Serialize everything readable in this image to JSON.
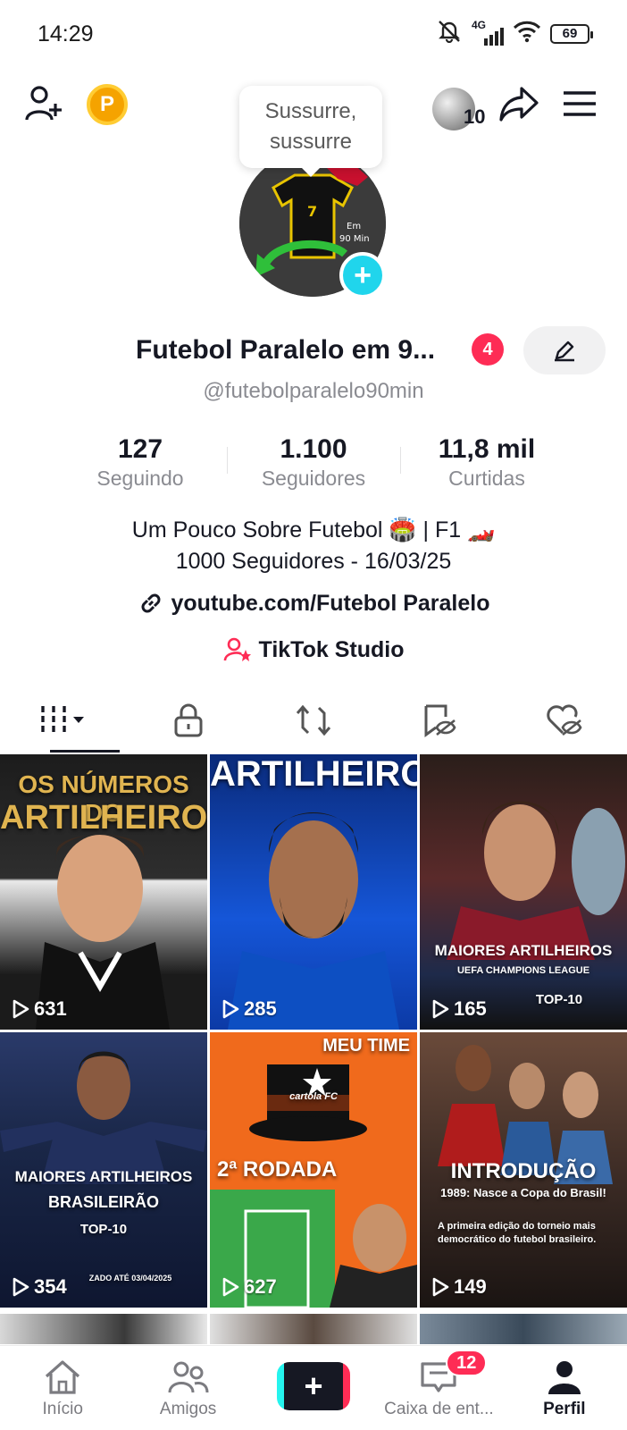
{
  "status_bar": {
    "time": "14:29",
    "network": "4G",
    "battery": "69"
  },
  "top_bar": {
    "coin_letter": "P",
    "story_count": "10"
  },
  "tooltip": {
    "line1": "Sussurre,",
    "line2": "sussurre"
  },
  "profile": {
    "avatar_text_top": "Em",
    "avatar_text_bottom": "90 Min",
    "name": "Futebol Paralelo em 9...",
    "notification_count": "4",
    "handle": "@futebolparalelo90min",
    "stats": [
      {
        "value": "127",
        "label": "Seguindo"
      },
      {
        "value": "1.100",
        "label": "Seguidores"
      },
      {
        "value": "11,8 mil",
        "label": "Curtidas"
      }
    ],
    "bio_line1": "Um Pouco Sobre Futebol 🏟️ | F1 🏎️",
    "bio_line2": "1000 Seguidores - 16/03/25",
    "link": "youtube.com/Futebol Paralelo",
    "studio": "TikTok Studio"
  },
  "videos": [
    {
      "views": "631",
      "caption_top": "OS NÚMEROS DO",
      "caption_main": "ARTILHEIRO",
      "bg": "#2a2a2a"
    },
    {
      "views": "285",
      "caption_top": "",
      "caption_main": "ARTILHEIRO",
      "bg": "#0e3a9a"
    },
    {
      "views": "165",
      "caption_top": "MAIORES ARTILHEIROS",
      "caption_main": "UEFA CHAMPIONS LEAGUE",
      "caption_extra": "TOP-10",
      "bg": "#3a1a1a"
    },
    {
      "views": "354",
      "caption_top": "MAIORES ARTILHEIROS",
      "caption_main": "BRASILEIRÃO",
      "caption_extra": "TOP-10",
      "caption_small": "ZADO ATÉ 03/04/2025",
      "bg": "#1b2748"
    },
    {
      "views": "627",
      "caption_top": "MEU TIME",
      "caption_main": "2ª RODADA",
      "caption_brand": "cartola FC",
      "bg": "#f06a1c"
    },
    {
      "views": "149",
      "caption_top": "INTRODUÇÃO",
      "caption_main": "1989: Nasce a Copa do Brasil!",
      "caption_extra": "A primeira edição do torneio mais democrático do futebol brasileiro.",
      "bg": "#4b3a30"
    }
  ],
  "bottom_nav": {
    "home": "Início",
    "friends": "Amigos",
    "inbox": "Caixa de ent...",
    "inbox_badge": "12",
    "profile": "Perfil"
  },
  "colors": {
    "accent_red": "#fe2c55",
    "accent_cyan": "#25f4ee",
    "text_primary": "#161823",
    "text_secondary": "#8a8b91"
  }
}
